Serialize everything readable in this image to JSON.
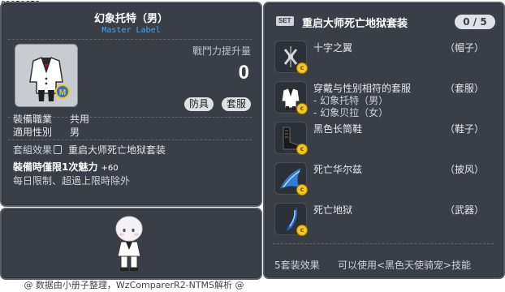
{
  "header_id": "01050678",
  "item": {
    "name": "幻象托特（男）",
    "label": "Master Label",
    "power_label": "戰鬥力提升量",
    "power_value": "0",
    "tags": [
      "防具",
      "套服"
    ],
    "stats": [
      {
        "key": "裝備職業",
        "value": "共用"
      },
      {
        "key": "適用性別",
        "value": "男"
      }
    ],
    "set_effect_key": "套組效果",
    "set_effect_value": "重启大师死亡地狱套装",
    "charm_text": "裝備時僅限1次魅力",
    "charm_value": "+60",
    "limit_text": "每日限制、超過上限時除外"
  },
  "set": {
    "badge": "SET",
    "title": "重启大师死亡地狱套装",
    "count": "0 / 5",
    "pieces": [
      {
        "name": "十字之翼",
        "slot": "（帽子）",
        "icon": "cross-wing-hat-icon"
      },
      {
        "name": "穿戴与性别相符的套服",
        "slot": "（套服）",
        "icon": "suit-icon",
        "subs": [
          "- 幻象托特（男）",
          "- 幻象贝拉（女）"
        ]
      },
      {
        "name": "黑色长筒鞋",
        "slot": "（鞋子）",
        "icon": "black-boots-icon"
      },
      {
        "name": "死亡华尔兹",
        "slot": "（披风）",
        "icon": "death-waltz-cape-icon"
      },
      {
        "name": "死亡地狱",
        "slot": "（武器）",
        "icon": "death-hell-weapon-icon"
      }
    ],
    "effect_label": "5套装效果",
    "effect_desc": "可以使用<黑色天使骑宠>技能"
  },
  "footer": "@ 数据由小册子整理，WzComparerR2-NTMS解析 @"
}
